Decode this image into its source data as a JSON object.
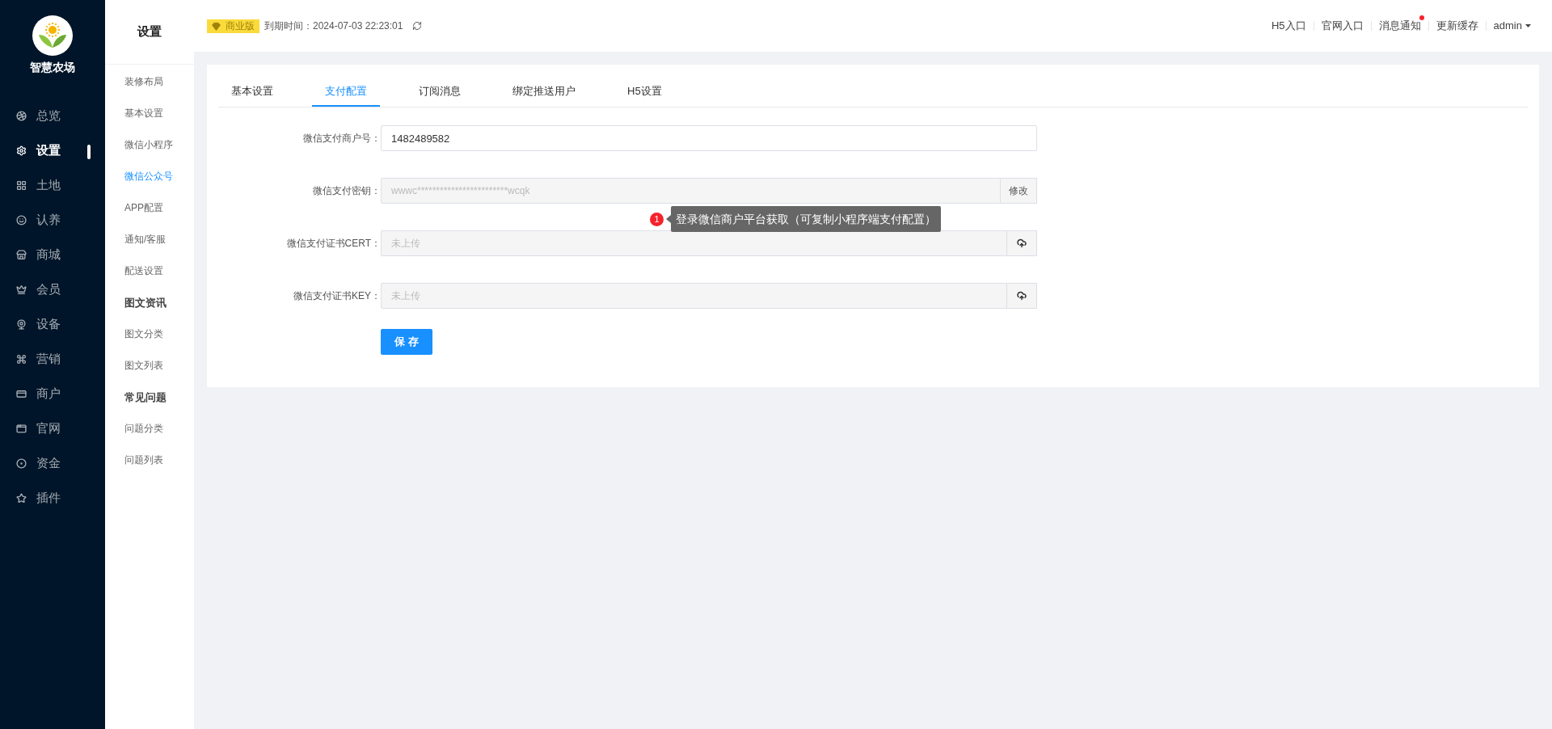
{
  "logo": {
    "name": "智慧农场"
  },
  "nav": [
    {
      "label": "总览",
      "selected": false
    },
    {
      "label": "设置",
      "selected": true
    },
    {
      "label": "土地",
      "selected": false
    },
    {
      "label": "认养",
      "selected": false
    },
    {
      "label": "商城",
      "selected": false
    },
    {
      "label": "会员",
      "selected": false
    },
    {
      "label": "设备",
      "selected": false
    },
    {
      "label": "营销",
      "selected": false
    },
    {
      "label": "商户",
      "selected": false
    },
    {
      "label": "官网",
      "selected": false
    },
    {
      "label": "资金",
      "selected": false
    },
    {
      "label": "插件",
      "selected": false
    }
  ],
  "subnav": {
    "title": "设置",
    "items": [
      {
        "kind": "link",
        "label": "装修布局",
        "selected": false
      },
      {
        "kind": "link",
        "label": "基本设置",
        "selected": false
      },
      {
        "kind": "link",
        "label": "微信小程序",
        "selected": false
      },
      {
        "kind": "link",
        "label": "微信公众号",
        "selected": true
      },
      {
        "kind": "link",
        "label": "APP配置",
        "selected": false
      },
      {
        "kind": "link",
        "label": "通知/客服",
        "selected": false
      },
      {
        "kind": "link",
        "label": "配送设置",
        "selected": false
      },
      {
        "kind": "heading",
        "label": "图文资讯"
      },
      {
        "kind": "link",
        "label": "图文分类",
        "selected": false
      },
      {
        "kind": "link",
        "label": "图文列表",
        "selected": false
      },
      {
        "kind": "heading",
        "label": "常见问题"
      },
      {
        "kind": "link",
        "label": "问题分类",
        "selected": false
      },
      {
        "kind": "link",
        "label": "问题列表",
        "selected": false
      }
    ]
  },
  "header": {
    "edition": "商业版",
    "expiry": "到期时间：2024-07-03 22:23:01",
    "links": [
      {
        "label": "H5入口",
        "dot": false
      },
      {
        "label": "官网入口",
        "dot": false
      },
      {
        "label": "消息通知",
        "dot": true
      },
      {
        "label": "更新缓存",
        "dot": false
      }
    ],
    "user": "admin"
  },
  "tabs": [
    {
      "label": "基本设置",
      "selected": false
    },
    {
      "label": "支付配置",
      "selected": true
    },
    {
      "label": "订阅消息",
      "selected": false
    },
    {
      "label": "绑定推送用户",
      "selected": false
    },
    {
      "label": "H5设置",
      "selected": false
    }
  ],
  "form": [
    {
      "kind": "text",
      "label": "微信支付商户号：",
      "value": "1482489582"
    },
    {
      "kind": "secret",
      "label": "微信支付密钥：",
      "value": "wwwc************************wcqk",
      "button": "修改"
    },
    {
      "kind": "upload",
      "label": "微信支付证书CERT：",
      "placeholder": "未上传"
    },
    {
      "kind": "upload",
      "label": "微信支付证书KEY：",
      "placeholder": "未上传"
    }
  ],
  "tooltip": {
    "badge": "1",
    "text": "登录微信商户平台获取（可复制小程序端支付配置）"
  },
  "save": "保 存"
}
